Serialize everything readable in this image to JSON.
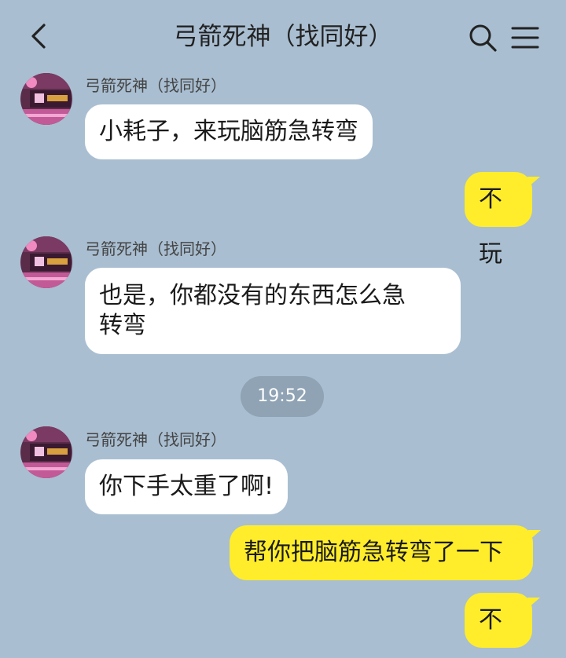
{
  "header": {
    "title": "弓箭死神（找同好）",
    "icons": [
      "back-icon",
      "search-icon",
      "menu-icon"
    ]
  },
  "messages": [
    {
      "side": "left",
      "sender": "弓箭死神（找同好）",
      "text": "小耗子，来玩脑筋急转弯"
    },
    {
      "side": "right",
      "text": "不玩"
    },
    {
      "side": "left",
      "sender": "弓箭死神（找同好）",
      "line1": "也是，你都没有的东西怎么急",
      "line2": "转弯"
    },
    {
      "side": "left",
      "sender": "弓箭死神（找同好）",
      "text": "你下手太重了啊!"
    },
    {
      "side": "right",
      "text": "帮你把脑筋急转弯了一下"
    },
    {
      "side": "right",
      "text": "不谢"
    }
  ],
  "timestamp": "19:52",
  "colors": {
    "background": "#a9bed1",
    "left_bubble": "#ffffff",
    "right_bubble": "#ffed2b",
    "timestamp_pill": "#8fa3b4"
  }
}
